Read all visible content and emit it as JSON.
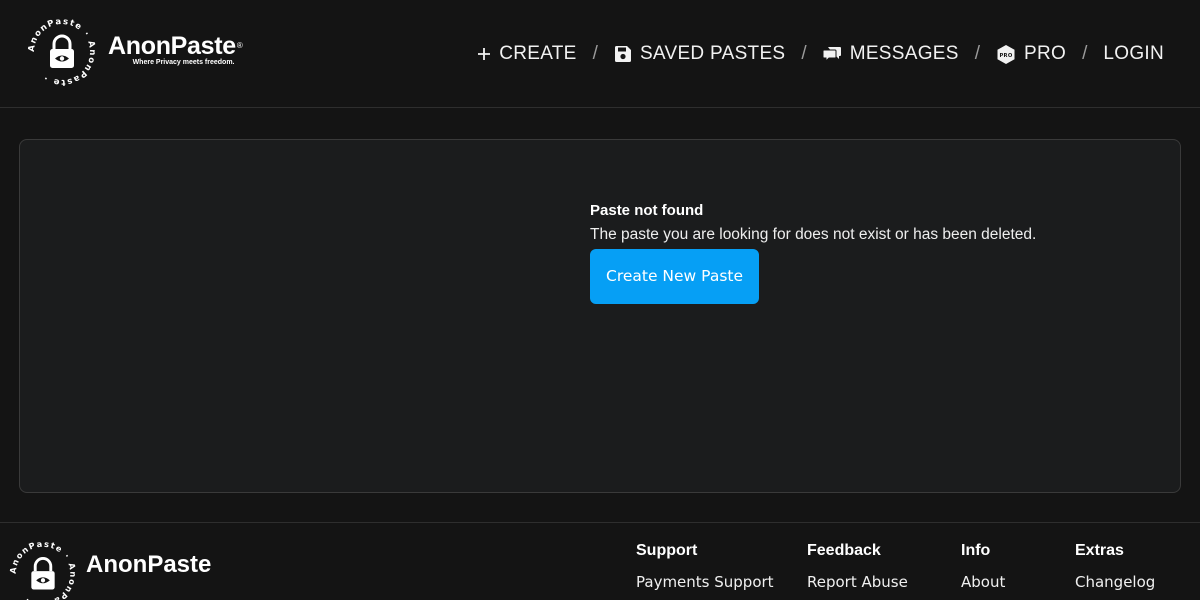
{
  "brand": {
    "name": "AnonPaste",
    "registered": "®",
    "tagline": "Where Privacy meets freedom.",
    "ring_text": "AnonPaste · AnonPaste ·"
  },
  "nav": {
    "create": "CREATE",
    "saved": "SAVED PASTES",
    "messages": "MESSAGES",
    "pro": "PRO",
    "pro_badge": "PRO",
    "login": "LOGIN",
    "separator": "/"
  },
  "main": {
    "title": "Paste not found",
    "text": "The paste you are looking for does not exist or has been deleted.",
    "button": "Create New Paste"
  },
  "footer": {
    "brand": "AnonPaste",
    "columns": [
      {
        "heading": "Support",
        "link": "Payments Support"
      },
      {
        "heading": "Feedback",
        "link": "Report Abuse"
      },
      {
        "heading": "Info",
        "link": "About"
      },
      {
        "heading": "Extras",
        "link": "Changelog"
      }
    ]
  },
  "colors": {
    "background": "#141414",
    "card": "#1b1c1d",
    "accent": "#069ff5"
  }
}
